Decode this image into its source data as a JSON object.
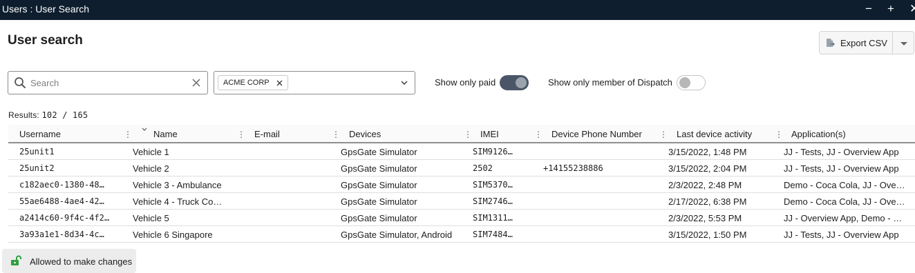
{
  "window": {
    "title": "Users : User Search",
    "minimize": "−",
    "maximize": "+",
    "close": "✕"
  },
  "page": {
    "title": "User search"
  },
  "export": {
    "label": "Export CSV",
    "icon": "file-export-icon"
  },
  "filters": {
    "search_placeholder": "Search",
    "search_value": "",
    "company_chip": "ACME CORP",
    "show_only_paid": {
      "label": "Show only paid",
      "on": true
    },
    "show_only_dispatch": {
      "label": "Show only member of Dispatch",
      "on": false
    }
  },
  "results": {
    "label": "Results:",
    "value": "102 / 165"
  },
  "table": {
    "columns": [
      "Username",
      "Name",
      "E-mail",
      "Devices",
      "IMEI",
      "Device Phone Number",
      "Last device activity",
      "Application(s)"
    ],
    "rows": [
      {
        "username": "25unit1",
        "name": "Vehicle 1",
        "email": "",
        "devices": "GpsGate Simulator",
        "imei": "SIM9126…",
        "phone": "",
        "last_activity": "3/15/2022, 1:48 PM",
        "apps": "JJ - Tests, JJ - Overview App"
      },
      {
        "username": "25unit2",
        "name": "Vehicle 2",
        "email": "",
        "devices": "GpsGate Simulator",
        "imei": "2502",
        "phone": "+14155238886",
        "last_activity": "3/15/2022, 2:04 PM",
        "apps": "JJ - Tests, JJ - Overview App"
      },
      {
        "username": "c182aec0-1380-48…",
        "name": "Vehicle 3 - Ambulance",
        "email": "",
        "devices": "GpsGate Simulator",
        "imei": "SIM5370…",
        "phone": "",
        "last_activity": "2/3/2022, 2:48 PM",
        "apps": "Demo - Coca Cola, JJ - Ove…"
      },
      {
        "username": "55ae6488-4ae4-42…",
        "name": "Vehicle 4 - Truck Co…",
        "email": "",
        "devices": "GpsGate Simulator",
        "imei": "SIM2746…",
        "phone": "",
        "last_activity": "2/17/2022, 6:38 PM",
        "apps": "Demo - Coca Cola, JJ - Ove…"
      },
      {
        "username": "a2414c60-9f4c-4f2…",
        "name": "Vehicle 5",
        "email": "",
        "devices": "GpsGate Simulator",
        "imei": "SIM1311…",
        "phone": "",
        "last_activity": "2/3/2022, 5:53 PM",
        "apps": "JJ - Overview App, Demo - …"
      },
      {
        "username": "3a93a1e1-8d34-4c…",
        "name": "Vehicle 6 Singapore",
        "email": "",
        "devices": "GpsGate Simulator, Android",
        "imei": "SIM7484…",
        "phone": "",
        "last_activity": "3/15/2022, 1:50 PM",
        "apps": "JJ - Tests, JJ - Overview App"
      }
    ]
  },
  "footer": {
    "label": "Allowed to make changes",
    "icon": "unlocked-icon"
  },
  "colors": {
    "titlebar": "#0e1e2e",
    "toggle_on": "#4a5668",
    "lock_green": "#2e9e3e"
  }
}
